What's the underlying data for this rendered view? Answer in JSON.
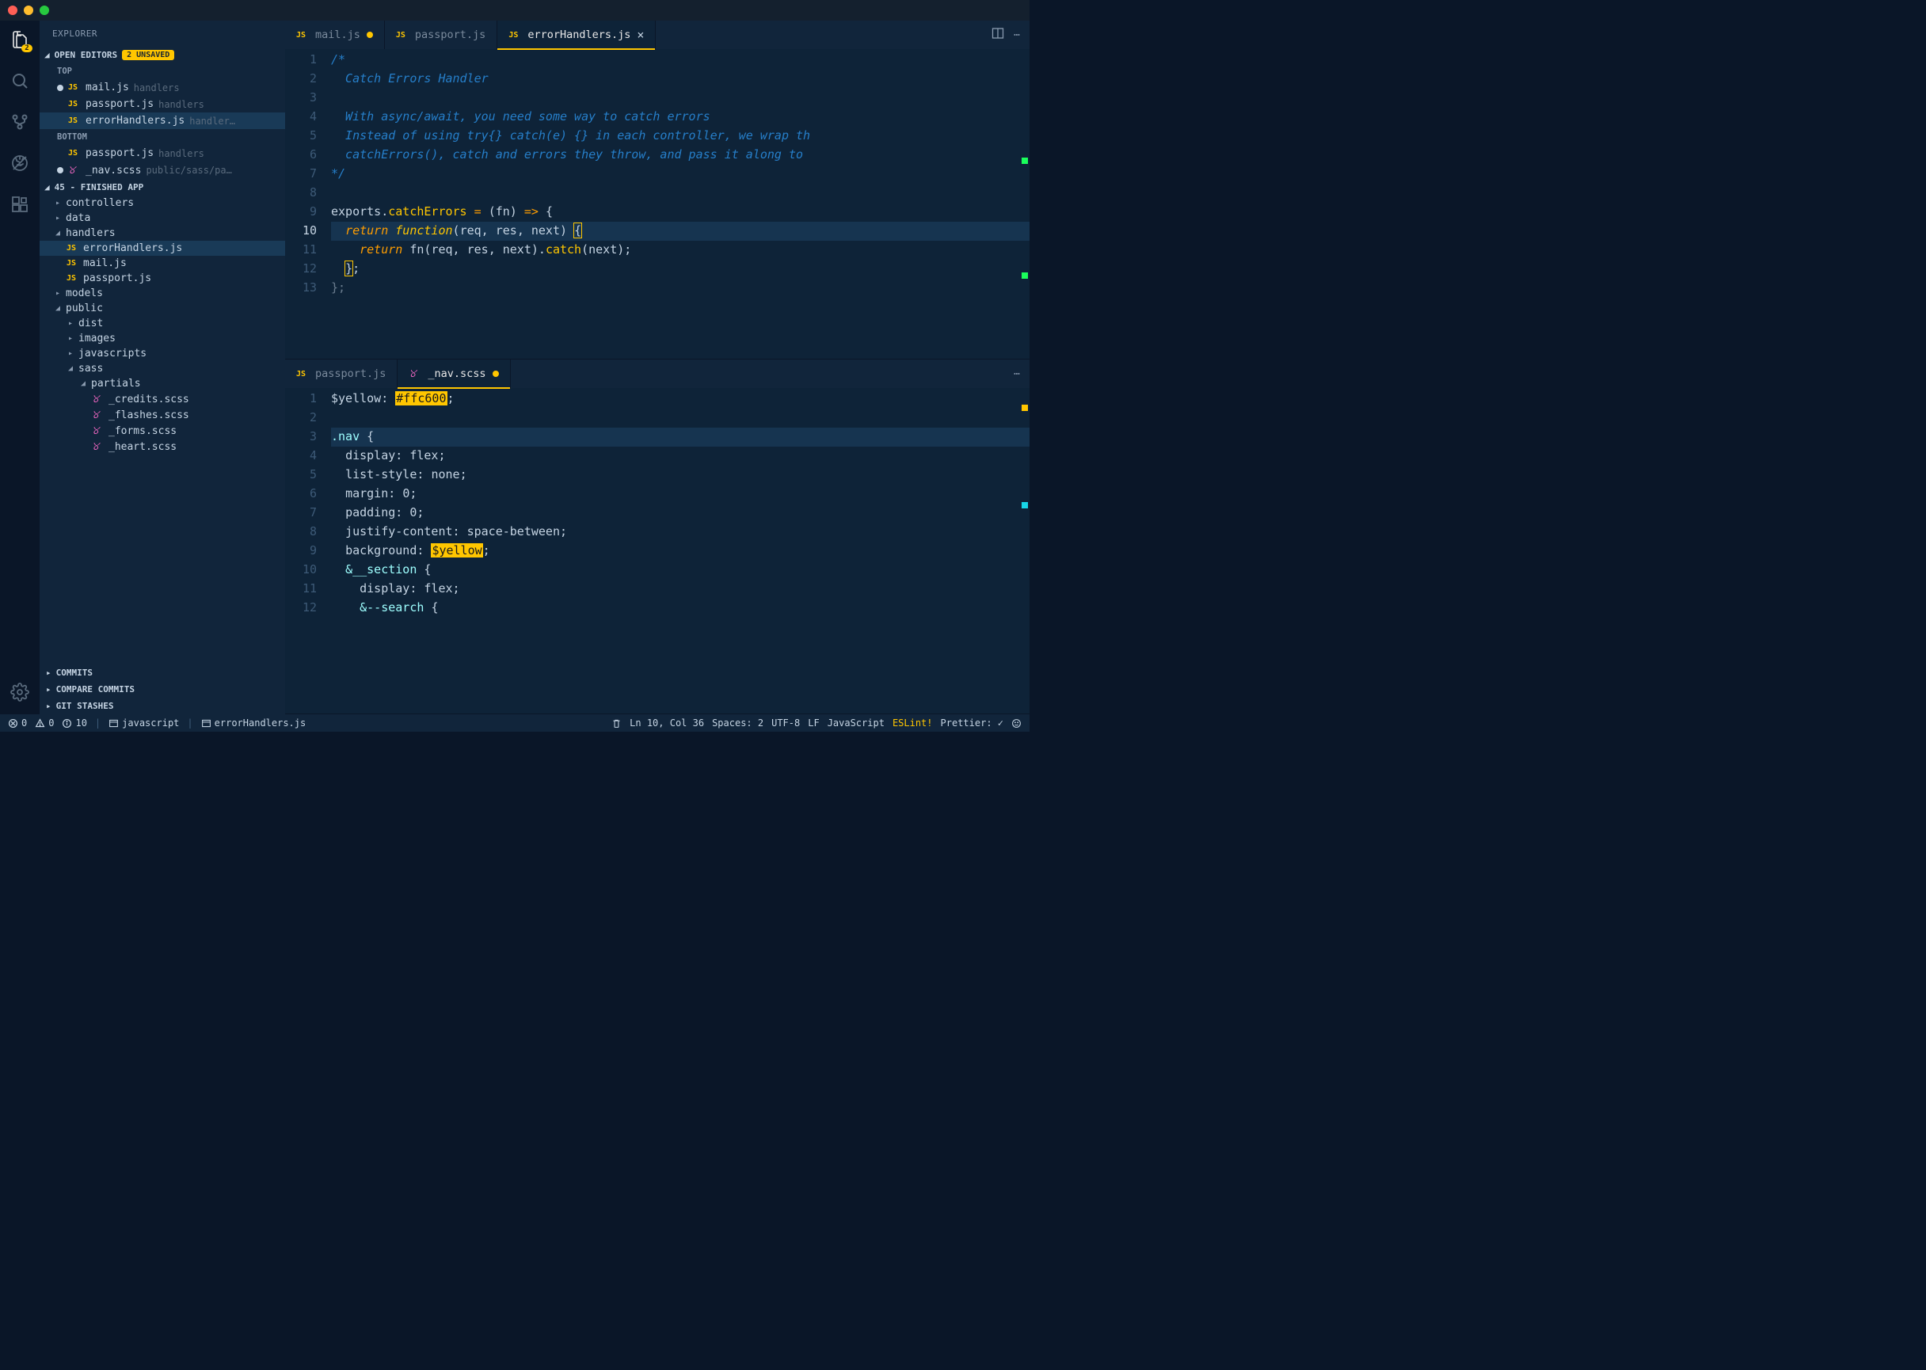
{
  "titlebar": {},
  "activity": {
    "files_badge": "2"
  },
  "sidebar": {
    "title": "EXPLORER",
    "open_editors": {
      "label": "OPEN EDITORS",
      "unsaved_badge": "2 UNSAVED",
      "groups": [
        {
          "label": "TOP",
          "items": [
            {
              "modified": true,
              "icon": "js",
              "name": "mail.js",
              "dir": "handlers"
            },
            {
              "modified": false,
              "icon": "js",
              "name": "passport.js",
              "dir": "handlers"
            },
            {
              "modified": false,
              "icon": "js",
              "name": "errorHandlers.js",
              "dir": "handler…",
              "active": true
            }
          ]
        },
        {
          "label": "BOTTOM",
          "items": [
            {
              "modified": false,
              "icon": "js",
              "name": "passport.js",
              "dir": "handlers"
            },
            {
              "modified": true,
              "icon": "sass",
              "name": "_nav.scss",
              "dir": "public/sass/pa…"
            }
          ]
        }
      ]
    },
    "project": {
      "header": "45 - FINISHED APP",
      "tree": [
        {
          "depth": 0,
          "type": "folder",
          "open": false,
          "name": "controllers"
        },
        {
          "depth": 0,
          "type": "folder",
          "open": false,
          "name": "data"
        },
        {
          "depth": 0,
          "type": "folder",
          "open": true,
          "name": "handlers"
        },
        {
          "depth": 1,
          "type": "file",
          "icon": "js",
          "name": "errorHandlers.js",
          "active": true
        },
        {
          "depth": 1,
          "type": "file",
          "icon": "js",
          "name": "mail.js"
        },
        {
          "depth": 1,
          "type": "file",
          "icon": "js",
          "name": "passport.js"
        },
        {
          "depth": 0,
          "type": "folder",
          "open": false,
          "name": "models"
        },
        {
          "depth": 0,
          "type": "folder",
          "open": true,
          "name": "public"
        },
        {
          "depth": 1,
          "type": "folder",
          "open": false,
          "name": "dist"
        },
        {
          "depth": 1,
          "type": "folder",
          "open": false,
          "name": "images"
        },
        {
          "depth": 1,
          "type": "folder",
          "open": false,
          "name": "javascripts"
        },
        {
          "depth": 1,
          "type": "folder",
          "open": true,
          "name": "sass"
        },
        {
          "depth": 2,
          "type": "folder",
          "open": true,
          "name": "partials"
        },
        {
          "depth": 3,
          "type": "file",
          "icon": "sass",
          "name": "_credits.scss"
        },
        {
          "depth": 3,
          "type": "file",
          "icon": "sass",
          "name": "_flashes.scss"
        },
        {
          "depth": 3,
          "type": "file",
          "icon": "sass",
          "name": "_forms.scss"
        },
        {
          "depth": 3,
          "type": "file",
          "icon": "sass",
          "name": "_heart.scss"
        }
      ]
    },
    "panels": [
      {
        "label": "COMMITS"
      },
      {
        "label": "COMPARE COMMITS"
      },
      {
        "label": "GIT STASHES"
      }
    ]
  },
  "editors": {
    "top": {
      "tabs": [
        {
          "icon": "js",
          "name": "mail.js",
          "modified": true
        },
        {
          "icon": "js",
          "name": "passport.js"
        },
        {
          "icon": "js",
          "name": "errorHandlers.js",
          "active": true,
          "closable": true
        }
      ],
      "actions": [
        "split",
        "more"
      ],
      "lines": [
        {
          "n": 1,
          "html": "<span class='tok-comment'>/*</span>"
        },
        {
          "n": 2,
          "html": "<span class='tok-comment'>  Catch Errors Handler</span>"
        },
        {
          "n": 3,
          "html": ""
        },
        {
          "n": 4,
          "html": "<span class='tok-comment'>  With async/await, you need some way to catch errors</span>"
        },
        {
          "n": 5,
          "html": "<span class='tok-comment'>  Instead of using try{} catch(e) {} in each controller, we wrap th</span>"
        },
        {
          "n": 6,
          "html": "<span class='tok-comment'>  catchErrors(), catch and errors they throw, and pass it along to </span>"
        },
        {
          "n": 7,
          "html": "<span class='tok-comment'>*/</span>"
        },
        {
          "n": 8,
          "html": ""
        },
        {
          "n": 9,
          "html": "<span class='tok-var'>exports</span><span class='tok-punc'>.</span><span class='tok-func'>catchErrors</span> <span class='tok-op'>=</span> <span class='tok-punc'>(</span><span class='tok-param'>fn</span><span class='tok-punc'>)</span> <span class='tok-op'>=&gt;</span> <span class='tok-punc'>{</span>"
        },
        {
          "n": 10,
          "curr": true,
          "hl": true,
          "html": "  <span class='tok-return'>return</span> <span class='tok-keyword-it'>function</span><span class='tok-punc'>(</span><span class='tok-param'>req</span><span class='tok-punc'>,</span> <span class='tok-param'>res</span><span class='tok-punc'>,</span> <span class='tok-param'>next</span><span class='tok-punc'>)</span> <span class='tok-punc bracket-box'>{</span>"
        },
        {
          "n": 11,
          "html": "    <span class='tok-return'>return</span> <span class='tok-var'>fn</span><span class='tok-punc'>(</span><span class='tok-param'>req</span><span class='tok-punc'>,</span> <span class='tok-param'>res</span><span class='tok-punc'>,</span> <span class='tok-param'>next</span><span class='tok-punc'>).</span><span class='tok-method'>catch</span><span class='tok-punc'>(</span><span class='tok-param'>next</span><span class='tok-punc'>);</span>"
        },
        {
          "n": 12,
          "html": "  <span class='tok-punc bracket-box'>}</span><span class='tok-punc'>;</span>"
        },
        {
          "n": 13,
          "html": "<span class='tok-punc' style='opacity:.5'>};</span>"
        }
      ]
    },
    "bottom": {
      "tabs": [
        {
          "icon": "js",
          "name": "passport.js"
        },
        {
          "icon": "sass",
          "name": "_nav.scss",
          "modified": true,
          "active": true
        }
      ],
      "actions": [
        "more"
      ],
      "lines": [
        {
          "n": 1,
          "html": "<span class='tok-sass-var'>$yellow</span><span class='tok-punc'>:</span> <span class='tok-hl-box'>#ffc600</span><span class='tok-punc'>;</span>"
        },
        {
          "n": 2,
          "html": ""
        },
        {
          "n": 3,
          "hl": true,
          "html": "<span class='tok-sel'>.nav</span> <span class='tok-punc'>{</span>"
        },
        {
          "n": 4,
          "html": "  <span class='tok-prop'>display</span><span class='tok-punc'>:</span> <span class='tok-val'>flex</span><span class='tok-punc'>;</span>"
        },
        {
          "n": 5,
          "html": "  <span class='tok-prop'>list-style</span><span class='tok-punc'>:</span> <span class='tok-val'>none</span><span class='tok-punc'>;</span>"
        },
        {
          "n": 6,
          "html": "  <span class='tok-prop'>margin</span><span class='tok-punc'>:</span> <span class='tok-val'>0</span><span class='tok-punc'>;</span>"
        },
        {
          "n": 7,
          "html": "  <span class='tok-prop'>padding</span><span class='tok-punc'>:</span> <span class='tok-val'>0</span><span class='tok-punc'>;</span>"
        },
        {
          "n": 8,
          "html": "  <span class='tok-prop'>justify-content</span><span class='tok-punc'>:</span> <span class='tok-val'>space-between</span><span class='tok-punc'>;</span>"
        },
        {
          "n": 9,
          "html": "  <span class='tok-prop'>background</span><span class='tok-punc'>:</span> <span class='tok-hl-box'>$yellow</span><span class='tok-punc'>;</span>"
        },
        {
          "n": 10,
          "html": "  <span class='tok-sel'>&amp;__section</span> <span class='tok-punc'>{</span>"
        },
        {
          "n": 11,
          "html": "    <span class='tok-prop'>display</span><span class='tok-punc'>:</span> <span class='tok-val'>flex</span><span class='tok-punc'>;</span>"
        },
        {
          "n": 12,
          "html": "    <span class='tok-sel'>&amp;--search</span> <span class='tok-punc'>{</span>"
        }
      ]
    }
  },
  "status": {
    "errors": "0",
    "warnings": "0",
    "info": "10",
    "lang_scope": "javascript",
    "file": "errorHandlers.js",
    "pos": "Ln 10, Col 36",
    "spaces": "Spaces: 2",
    "encoding": "UTF-8",
    "eol": "LF",
    "mode": "JavaScript",
    "eslint": "ESLint!",
    "prettier": "Prettier: ✓"
  }
}
